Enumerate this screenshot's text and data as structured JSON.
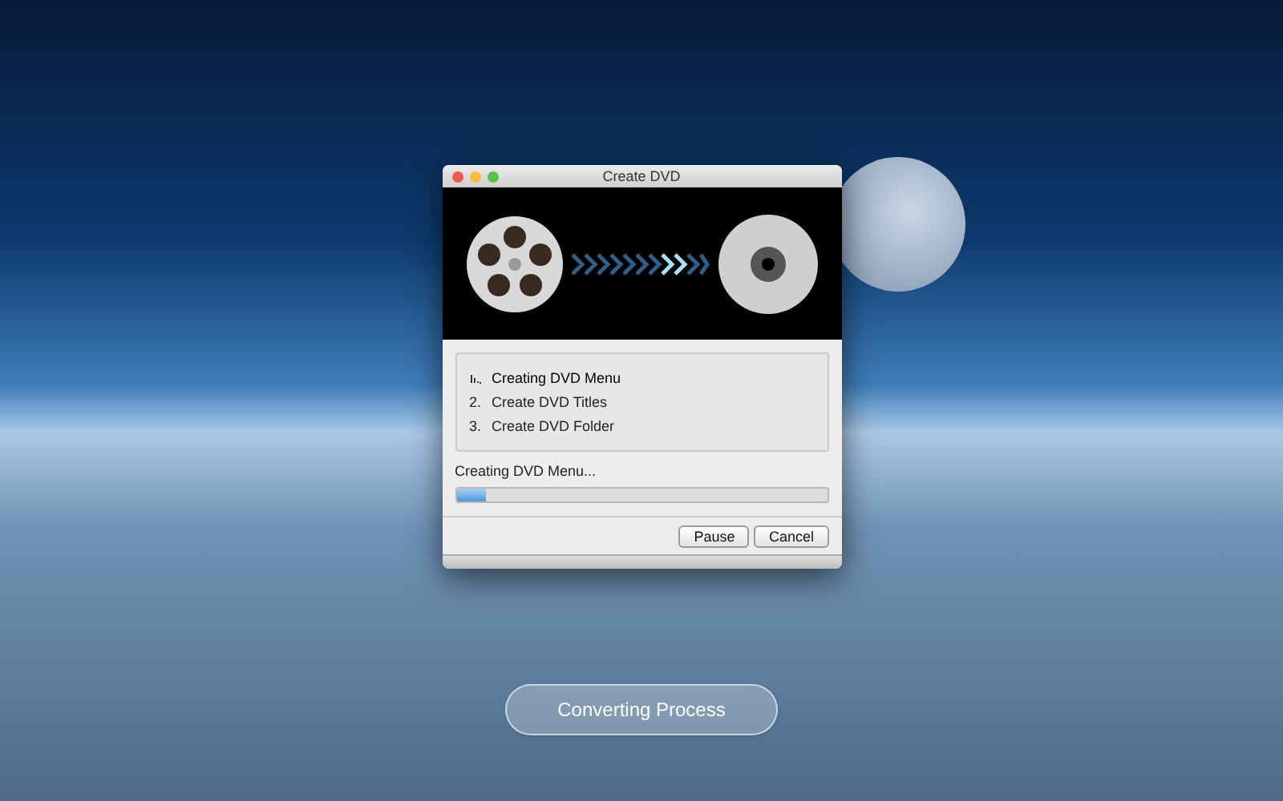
{
  "window": {
    "title": "Create DVD"
  },
  "steps": [
    {
      "label": "Creating DVD Menu",
      "active": true
    },
    {
      "number": "2.",
      "label": "Create DVD Titles",
      "active": false
    },
    {
      "number": "3.",
      "label": "Create DVD Folder",
      "active": false
    }
  ],
  "status": "Creating DVD Menu...",
  "progress": {
    "level": 0.08
  },
  "buttons": [
    {
      "label": "Pause"
    },
    {
      "label": "Cancel"
    }
  ],
  "converting_button": "Converting Process"
}
